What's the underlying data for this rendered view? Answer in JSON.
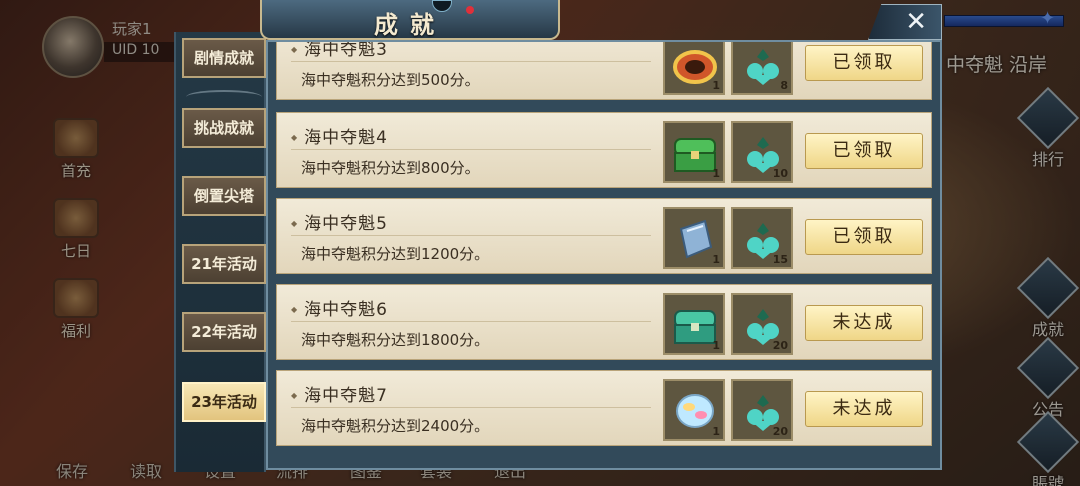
{
  "player": {
    "name": "玩家1",
    "uid": "UID 10"
  },
  "left_icons": [
    {
      "label": "首充",
      "icon": "gift-icon"
    },
    {
      "label": "七日",
      "icon": "calendar-icon"
    },
    {
      "label": "福利",
      "icon": "welfare-icon"
    }
  ],
  "right_icons": [
    {
      "label": "排行",
      "icon": "ranking-icon"
    },
    {
      "label": "成就",
      "icon": "achievement-icon"
    },
    {
      "label": "公告",
      "icon": "notice-icon"
    },
    {
      "label": "賬號",
      "icon": "account-icon"
    }
  ],
  "bottom_bar": [
    "保存",
    "读取",
    "设置",
    "流排",
    "图鉴",
    "套装",
    "退出"
  ],
  "top_right_text": "中夺魁 沿岸",
  "window": {
    "title": "成就"
  },
  "tabs": [
    {
      "label": "剧情成就",
      "active": false
    },
    {
      "label": "挑战成就",
      "active": false
    },
    {
      "label": "倒置尖塔",
      "active": false
    },
    {
      "label": "21年活动",
      "active": false
    },
    {
      "label": "22年活动",
      "active": false
    },
    {
      "label": "23年活动",
      "active": true
    }
  ],
  "achievements": [
    {
      "title": "海中夺魁3",
      "desc": "海中夺魁积分达到500分。",
      "item1_icon": "ring-icon",
      "item1_count": "1",
      "item2_icon": "jade-pendant-icon",
      "item2_count": "8",
      "status": "已领取"
    },
    {
      "title": "海中夺魁4",
      "desc": "海中夺魁积分达到800分。",
      "item1_icon": "green-chest-icon",
      "item1_count": "1",
      "item2_icon": "jade-pendant-icon",
      "item2_count": "10",
      "status": "已领取"
    },
    {
      "title": "海中夺魁5",
      "desc": "海中夺魁积分达到1200分。",
      "item1_icon": "crystal-book-icon",
      "item1_count": "1",
      "item2_icon": "jade-pendant-icon",
      "item2_count": "15",
      "status": "已领取"
    },
    {
      "title": "海中夺魁6",
      "desc": "海中夺魁积分达到1800分。",
      "item1_icon": "teal-chest-icon",
      "item1_count": "1",
      "item2_icon": "jade-pendant-icon",
      "item2_count": "20",
      "status": "未达成"
    },
    {
      "title": "海中夺魁7",
      "desc": "海中夺魁积分达到2400分。",
      "item1_icon": "opal-gem-icon",
      "item1_count": "1",
      "item2_icon": "jade-pendant-icon",
      "item2_count": "20",
      "status": "未达成"
    }
  ]
}
